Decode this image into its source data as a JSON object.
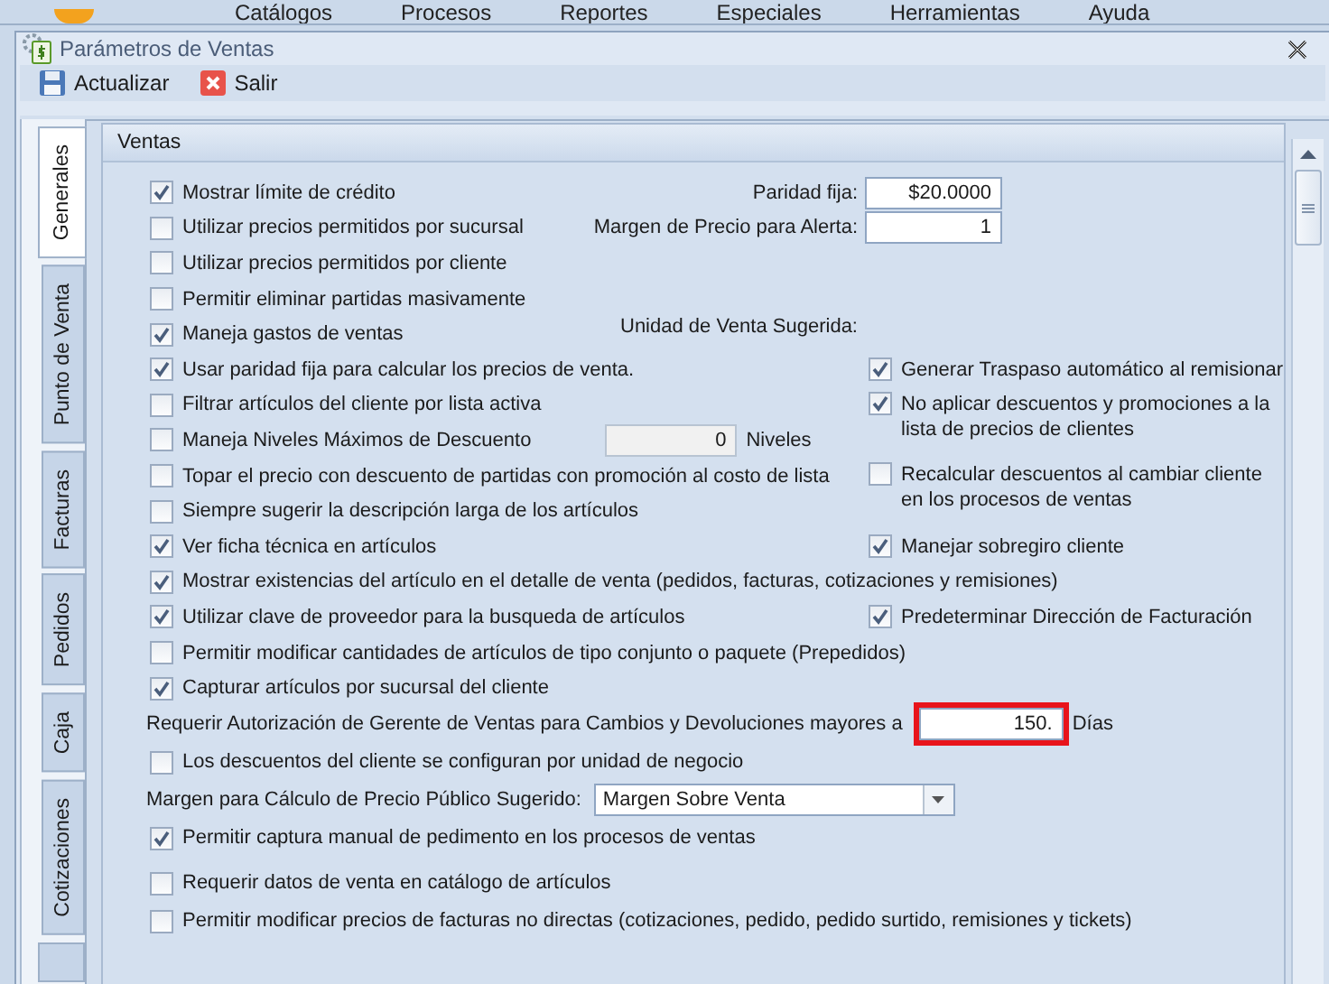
{
  "menu": [
    "Catálogos",
    "Procesos",
    "Reportes",
    "Especiales",
    "Herramientas",
    "Ayuda"
  ],
  "window": {
    "title": "Parámetros de Ventas"
  },
  "toolbar": [
    {
      "label": "Actualizar",
      "kind": "save"
    },
    {
      "label": "Salir",
      "kind": "exit"
    }
  ],
  "tabs": [
    {
      "label": "Generales",
      "selected": true
    },
    {
      "label": "Punto de Venta",
      "selected": false
    },
    {
      "label": "Facturas",
      "selected": false
    },
    {
      "label": "Pedidos",
      "selected": false
    },
    {
      "label": "Caja",
      "selected": false
    },
    {
      "label": "Cotizaciones",
      "selected": false
    }
  ],
  "group": {
    "title": "Ventas"
  },
  "left_options": [
    {
      "kind": "check",
      "label": "Mostrar límite de crédito",
      "checked": true
    },
    {
      "kind": "check",
      "label": "Utilizar precios permitidos por sucursal",
      "checked": false
    },
    {
      "kind": "check",
      "label": "Utilizar precios permitidos por cliente",
      "checked": false
    },
    {
      "kind": "check",
      "label": "Permitir eliminar partidas masivamente",
      "checked": false
    },
    {
      "kind": "check",
      "label": "Maneja gastos de ventas",
      "checked": true
    },
    {
      "kind": "check",
      "label": "Usar paridad fija para calcular los precios de venta.",
      "checked": true
    },
    {
      "kind": "check",
      "label": "Filtrar artículos del cliente por lista activa",
      "checked": false
    },
    {
      "kind": "levels",
      "label": "Maneja Niveles Máximos de Descuento",
      "checked": false,
      "value": "0",
      "suffix": "Niveles"
    },
    {
      "kind": "check",
      "label": "Topar el precio con descuento de partidas con promoción al costo de lista",
      "checked": false
    },
    {
      "kind": "check",
      "label": "Siempre sugerir la descripción larga de los artículos",
      "checked": false
    },
    {
      "kind": "check",
      "label": "Ver ficha técnica en artículos",
      "checked": true
    },
    {
      "kind": "check",
      "label": "Mostrar existencias del artículo en el detalle de venta (pedidos, facturas, cotizaciones y remisiones)",
      "checked": true
    },
    {
      "kind": "check",
      "label": "Utilizar clave de proveedor para la busqueda de artículos",
      "checked": true
    },
    {
      "kind": "check",
      "label": "Permitir modificar cantidades de artículos de tipo conjunto o paquete (Prepedidos)",
      "checked": false
    },
    {
      "kind": "check",
      "label": "Capturar artículos por sucursal del cliente",
      "checked": true
    }
  ],
  "right_fields": [
    {
      "label": "Paridad fija:",
      "value": "$20.0000"
    },
    {
      "label": "Margen de Precio para Alerta:",
      "value": "1"
    }
  ],
  "unit_label": "Unidad de Venta Sugerida:",
  "right_options": [
    {
      "label": "Generar Traspaso automático al remisionar",
      "checked": true
    },
    {
      "label": "No aplicar descuentos y promociones a la lista de precios de clientes",
      "checked": true
    },
    {
      "label": "Recalcular descuentos al cambiar cliente en los procesos de ventas",
      "checked": false
    },
    {
      "label": "Manejar sobregiro cliente",
      "checked": true
    },
    {
      "label": "Predeterminar Dirección de Facturación",
      "checked": true
    }
  ],
  "bottom_rows": [
    {
      "kind": "field",
      "label": "Requerir Autorización de Gerente de Ventas para Cambios y Devoluciones mayores a",
      "value": "150.",
      "suffix": "Días",
      "highlighted": true
    },
    {
      "kind": "check",
      "label": "Los descuentos del cliente se configuran por unidad de negocio",
      "checked": false
    },
    {
      "kind": "select",
      "label": "Margen para Cálculo de Precio Público Sugerido:",
      "value": "Margen Sobre Venta"
    },
    {
      "kind": "check",
      "label": "Permitir captura manual de pedimento en los procesos de ventas",
      "checked": true
    },
    {
      "kind": "check",
      "label": "Requerir datos de venta en catálogo de artículos",
      "checked": false
    },
    {
      "kind": "check",
      "label": "Permitir modificar precios de facturas no directas (cotizaciones, pedido, pedido surtido, remisiones y tickets)",
      "checked": false
    }
  ]
}
